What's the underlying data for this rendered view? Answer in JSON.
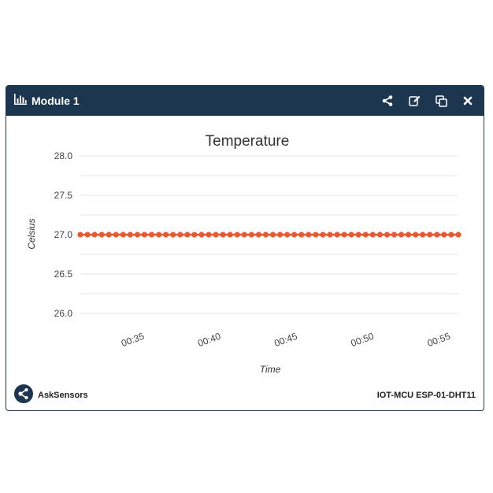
{
  "module": {
    "title": "Module 1",
    "icons": [
      "bar-chart-icon",
      "share-icon",
      "edit-icon",
      "copy-icon",
      "close-icon"
    ]
  },
  "footer": {
    "brand": "AskSensors",
    "device": "IOT-MCU ESP-01-DHT11"
  },
  "colors": {
    "header_bg": "#1c3650",
    "series": "#e8592d"
  },
  "chart_data": {
    "type": "line",
    "title": "Temperature",
    "xlabel": "Time",
    "ylabel": "Celsius",
    "ylim": [
      26.0,
      28.0
    ],
    "yticks": [
      "28.0",
      "27.5",
      "27.0",
      "26.5",
      "26.0"
    ],
    "xticks": [
      "00:35",
      "00:40",
      "00:45",
      "00:50",
      "00:55"
    ],
    "x_range_minutes": [
      31.5,
      56.2
    ],
    "xtick_minutes": [
      35,
      40,
      45,
      50,
      55
    ],
    "series": [
      {
        "values": [
          27,
          27,
          27,
          27,
          27,
          27,
          27,
          27,
          27,
          27,
          27,
          27,
          27,
          27,
          27,
          27,
          27,
          27,
          27,
          27,
          27,
          27,
          27,
          27,
          27,
          27,
          27,
          27,
          27,
          27,
          27,
          27,
          27,
          27,
          27,
          27,
          27,
          27,
          27,
          27,
          27,
          27,
          27,
          27,
          27,
          27,
          27,
          27,
          27,
          27,
          27,
          27,
          27,
          27
        ]
      }
    ],
    "grid": true
  }
}
